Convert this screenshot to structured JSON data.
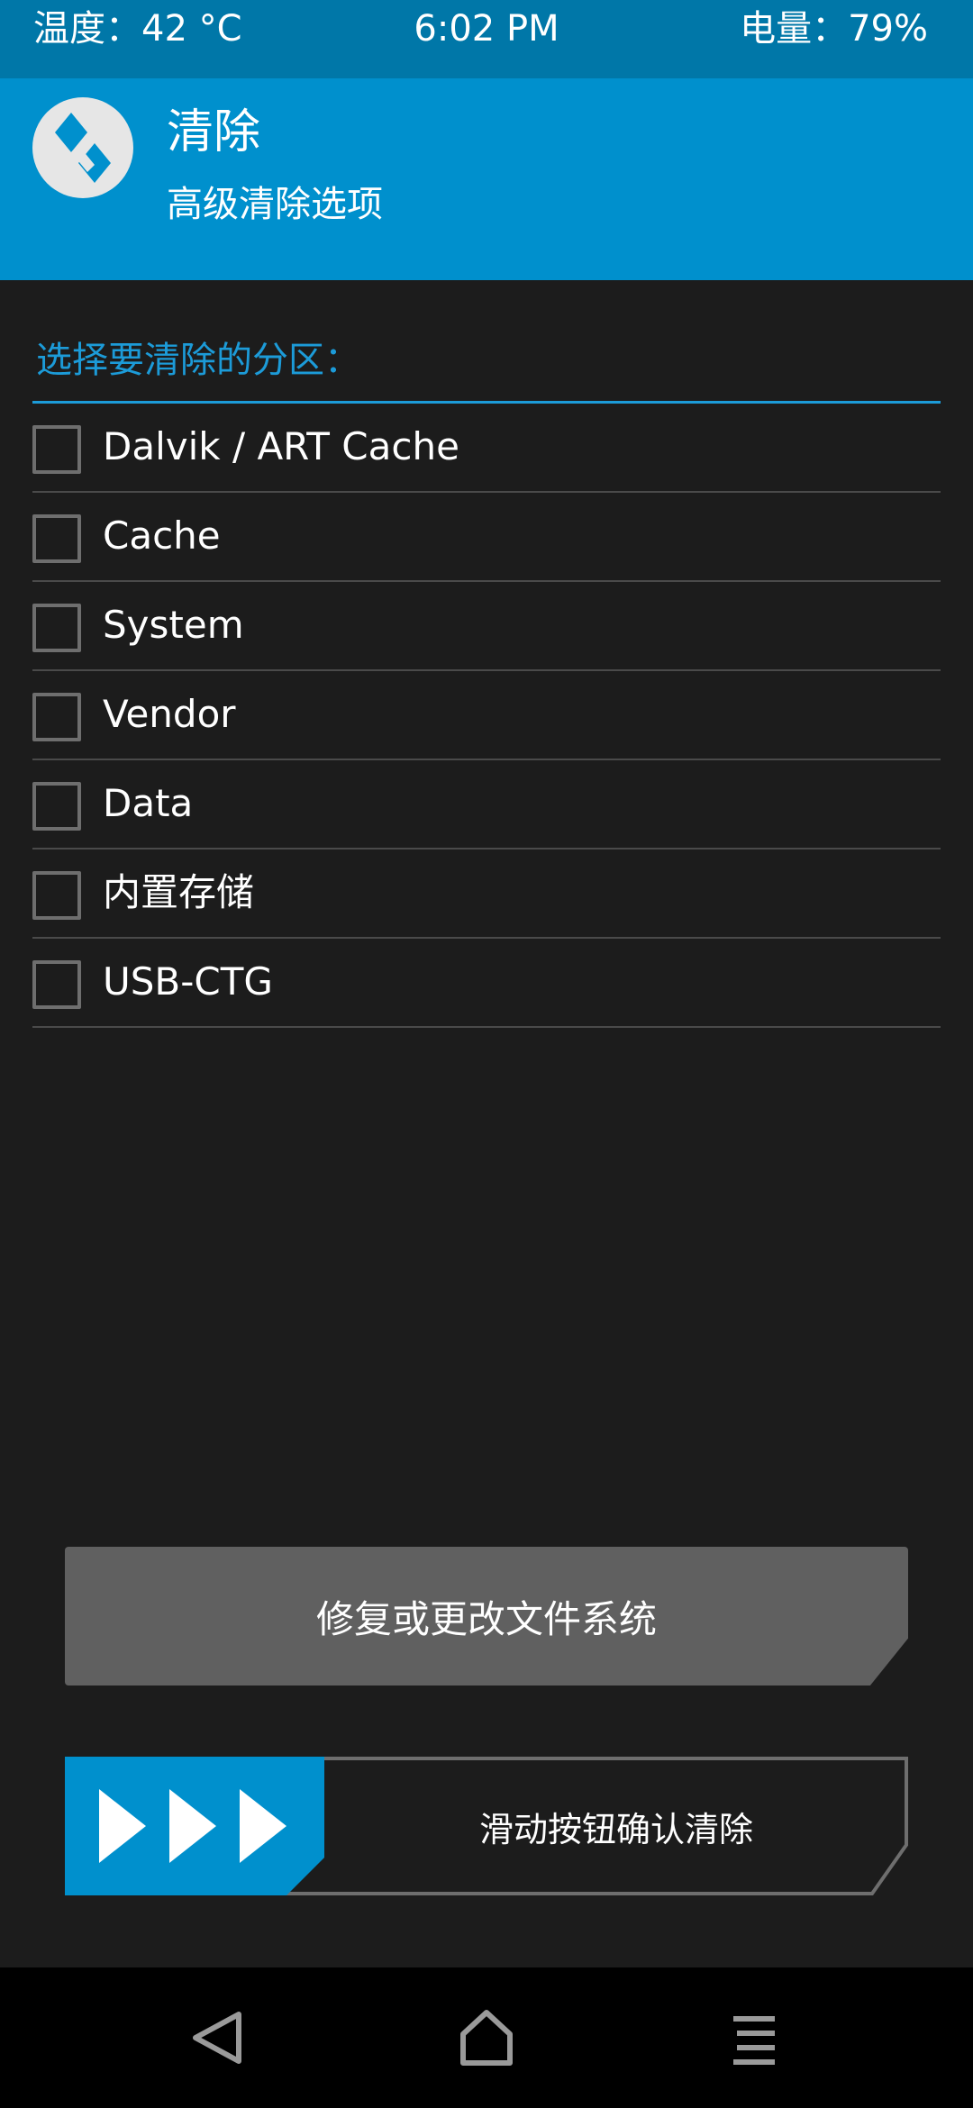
{
  "status_bar": {
    "temperature": "温度：42 °C",
    "time": "6:02 PM",
    "battery": "电量：79%"
  },
  "header": {
    "title": "清除",
    "subtitle": "高级清除选项",
    "logo_icon": "twrp-logo-icon"
  },
  "section": {
    "label": "选择要清除的分区："
  },
  "partitions": [
    {
      "label": "Dalvik / ART Cache",
      "checked": false
    },
    {
      "label": "Cache",
      "checked": false
    },
    {
      "label": "System",
      "checked": false
    },
    {
      "label": "Vendor",
      "checked": false
    },
    {
      "label": "Data",
      "checked": false
    },
    {
      "label": "内置存储",
      "checked": false
    },
    {
      "label": "USB-CTG",
      "checked": false
    }
  ],
  "actions": {
    "fix_button_label": "修复或更改文件系统",
    "swipe_label": "滑动按钮确认清除"
  },
  "navigation": {
    "back_icon": "back-triangle-icon",
    "home_icon": "home-icon",
    "menu_icon": "menu-icon"
  },
  "colors": {
    "accent": "#0090cd",
    "status_bar": "#0077a8",
    "background": "#1c1c1c",
    "button": "#606060"
  }
}
